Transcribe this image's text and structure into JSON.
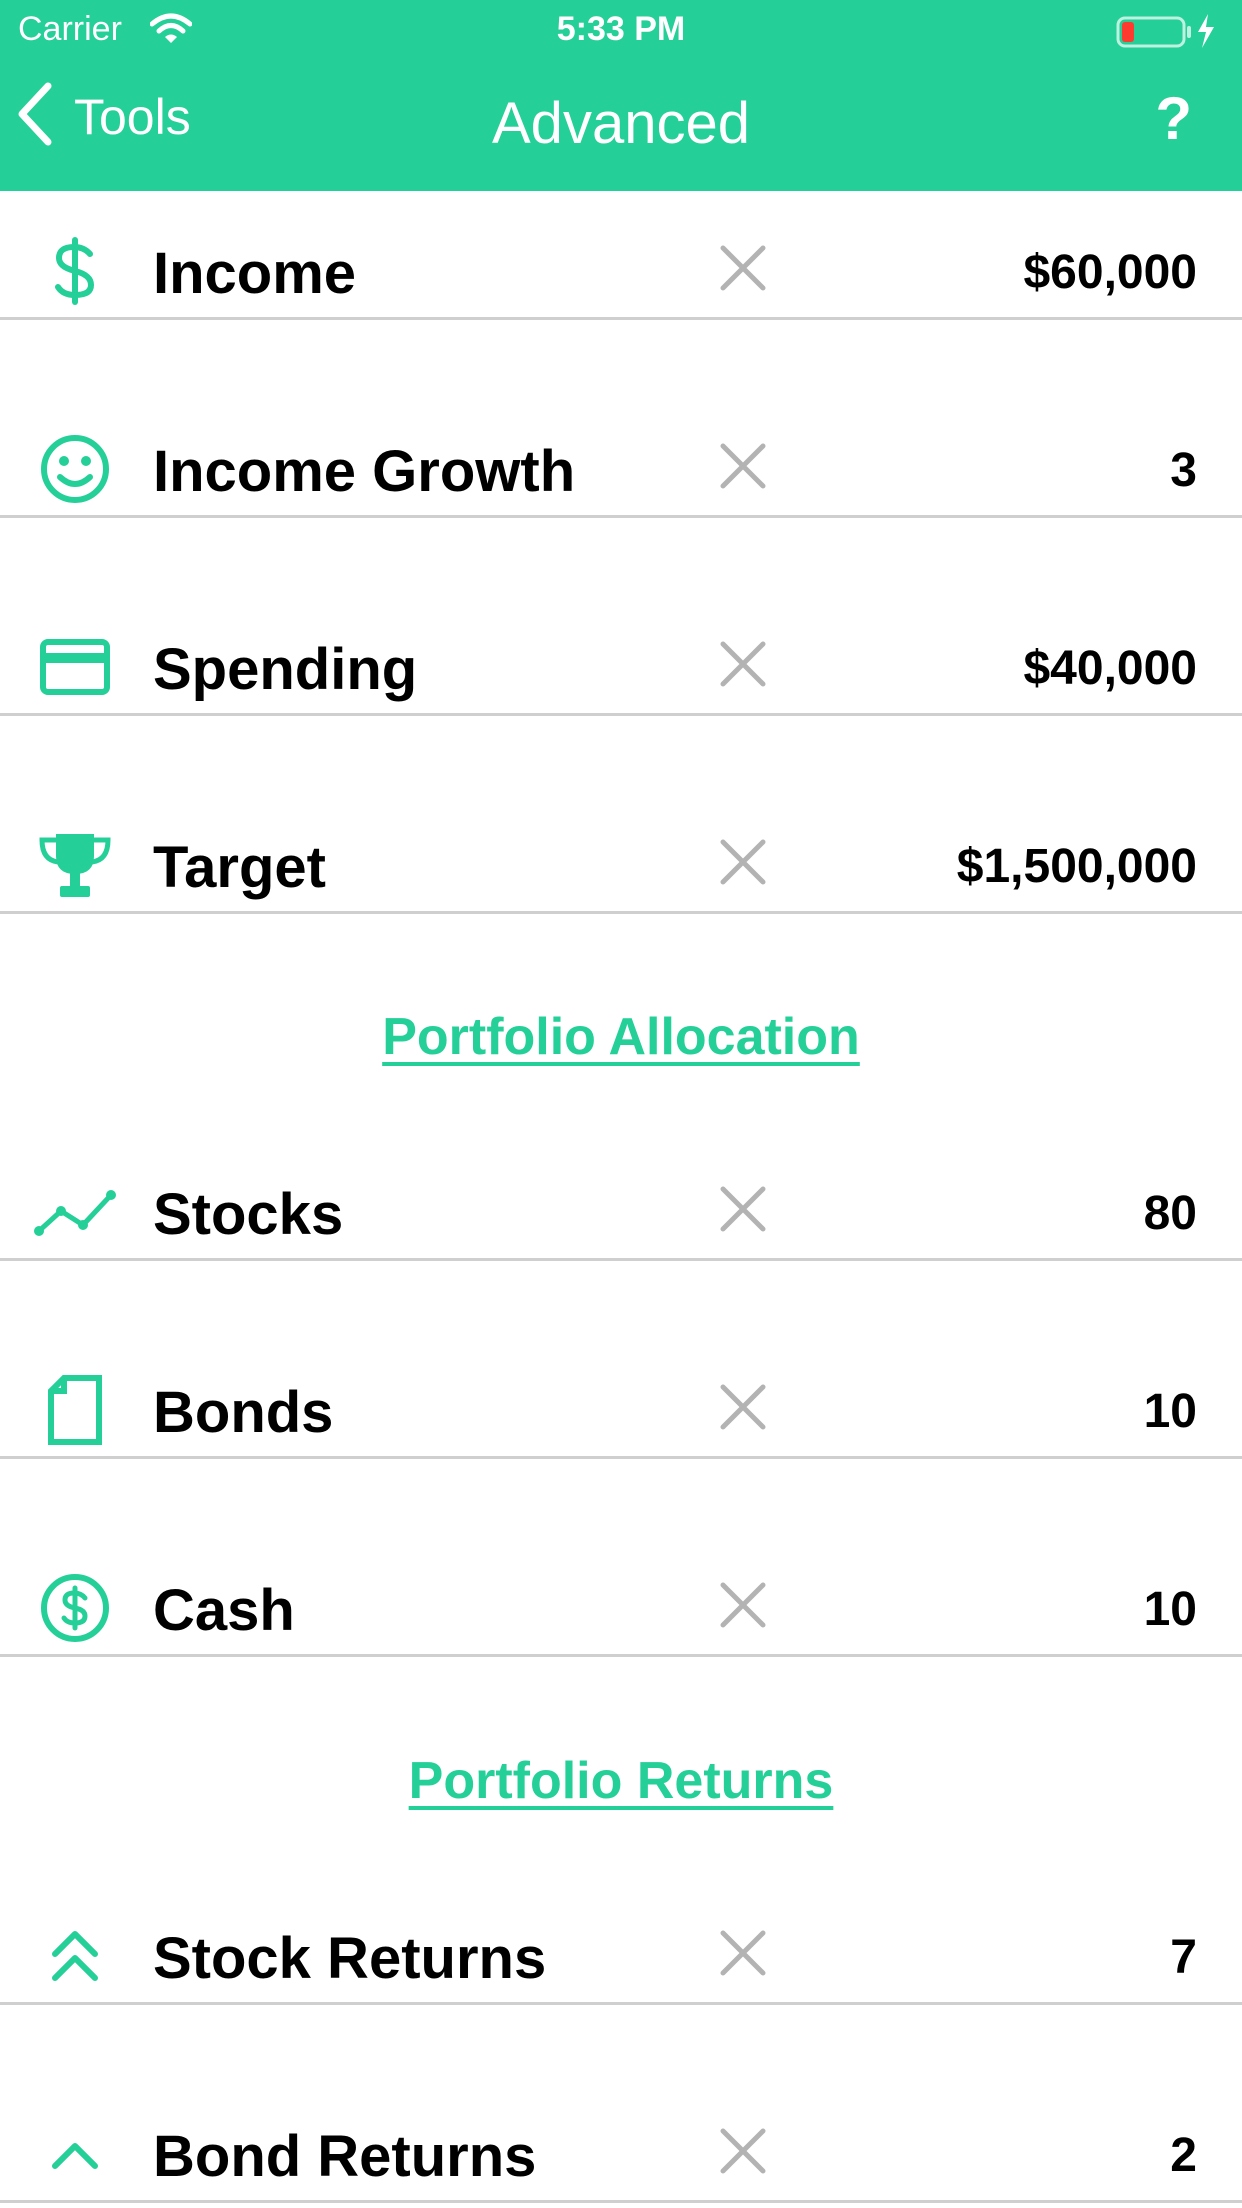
{
  "status_bar": {
    "carrier": "Carrier",
    "time": "5:33 PM"
  },
  "nav": {
    "back_label": "Tools",
    "title": "Advanced",
    "help_label": "?"
  },
  "colors": {
    "accent": "#24CF98",
    "divider": "#cfcfcf",
    "clear_icon": "#b3b3b3",
    "battery_low": "#ff3b30"
  },
  "rows": [
    {
      "icon": "dollar-icon",
      "label": "Income",
      "value": "$60,000"
    },
    {
      "icon": "smiley-icon",
      "label": "Income Growth",
      "value": "3"
    },
    {
      "icon": "credit-card-icon",
      "label": "Spending",
      "value": "$40,000"
    },
    {
      "icon": "trophy-icon",
      "label": "Target",
      "value": "$1,500,000"
    }
  ],
  "allocation": {
    "title": "Portfolio Allocation",
    "rows": [
      {
        "icon": "line-chart-icon",
        "label": "Stocks",
        "value": "80"
      },
      {
        "icon": "document-icon",
        "label": "Bonds",
        "value": "10"
      },
      {
        "icon": "coin-icon",
        "label": "Cash",
        "value": "10"
      }
    ]
  },
  "returns": {
    "title": "Portfolio Returns",
    "rows": [
      {
        "icon": "double-chevron-up-icon",
        "label": "Stock Returns",
        "value": "7"
      },
      {
        "icon": "chevron-up-icon",
        "label": "Bond Returns",
        "value": "2"
      }
    ]
  }
}
